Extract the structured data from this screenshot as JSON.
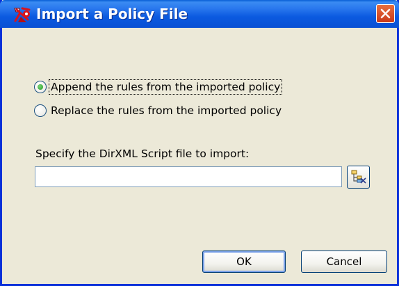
{
  "window": {
    "title": "Import a Policy File",
    "icon": "policy-import-icon",
    "close_icon": "close-icon"
  },
  "options": [
    {
      "label": "Append the rules from the imported policy",
      "selected": true,
      "focused": true
    },
    {
      "label": "Replace the rules from the imported policy",
      "selected": false,
      "focused": false
    }
  ],
  "file": {
    "label": "Specify the DirXML Script file to import:",
    "value": "",
    "placeholder": "",
    "browse_icon": "browse-tree-icon"
  },
  "buttons": {
    "ok": "OK",
    "cancel": "Cancel"
  },
  "colors": {
    "titlebar": "#0a5fd6",
    "dialog_bg": "#ece9d8",
    "close": "#c9391a",
    "radio_selected": "#21a121"
  }
}
